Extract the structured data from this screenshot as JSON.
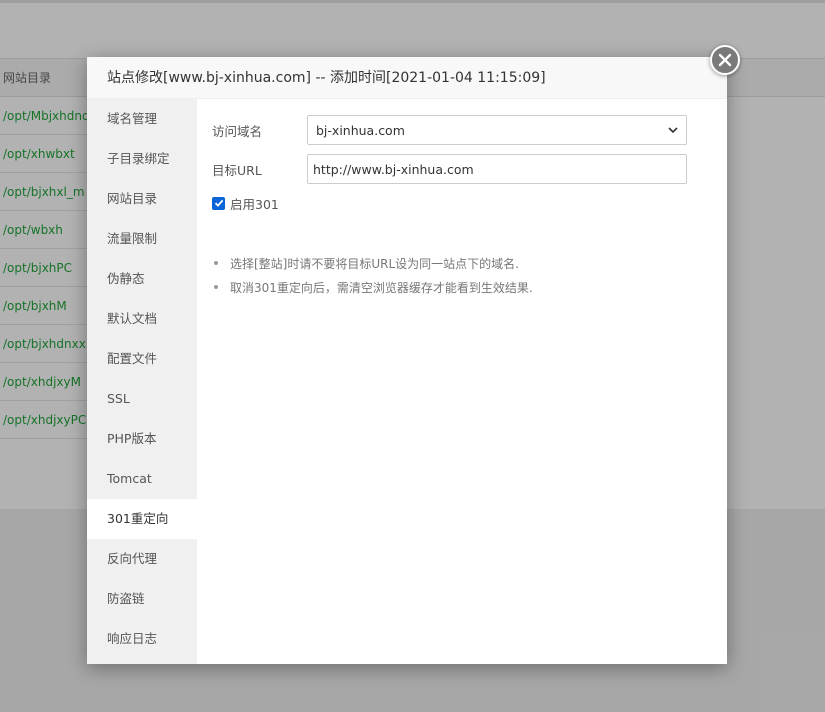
{
  "background": {
    "table_header": "网站目录",
    "rows": [
      "/opt/Mbjxhdnd",
      "/opt/xhwbxt",
      "/opt/bjxhxl_m",
      "/opt/wbxh",
      "/opt/bjxhPC",
      "/opt/bjxhM",
      "/opt/bjxhdnxx",
      "/opt/xhdjxyM",
      "/opt/xhdjxyPC"
    ]
  },
  "modal": {
    "title": "站点修改[www.bj-xinhua.com] -- 添加时间[2021-01-04 11:15:09]",
    "close_icon": "close-icon",
    "tabs": [
      {
        "label": "域名管理"
      },
      {
        "label": "子目录绑定"
      },
      {
        "label": "网站目录"
      },
      {
        "label": "流量限制"
      },
      {
        "label": "伪静态"
      },
      {
        "label": "默认文档"
      },
      {
        "label": "配置文件"
      },
      {
        "label": "SSL"
      },
      {
        "label": "PHP版本"
      },
      {
        "label": "Tomcat"
      },
      {
        "label": "301重定向",
        "active": true
      },
      {
        "label": "反向代理"
      },
      {
        "label": "防盗链"
      },
      {
        "label": "响应日志"
      }
    ],
    "form": {
      "domain_label": "访问域名",
      "domain_value": "bj-xinhua.com",
      "target_label": "目标URL",
      "target_value": "http://www.bj-xinhua.com",
      "enable_label": "启用301",
      "enable_checked": true
    },
    "notes": [
      "选择[整站]时请不要将目标URL设为同一站点下的域名.",
      "取消301重定向后，需清空浏览器缓存才能看到生效结果."
    ]
  },
  "colors": {
    "accent": "#20a53a",
    "checkbox": "#0a66d8",
    "close_button": "#7a7a7a"
  }
}
